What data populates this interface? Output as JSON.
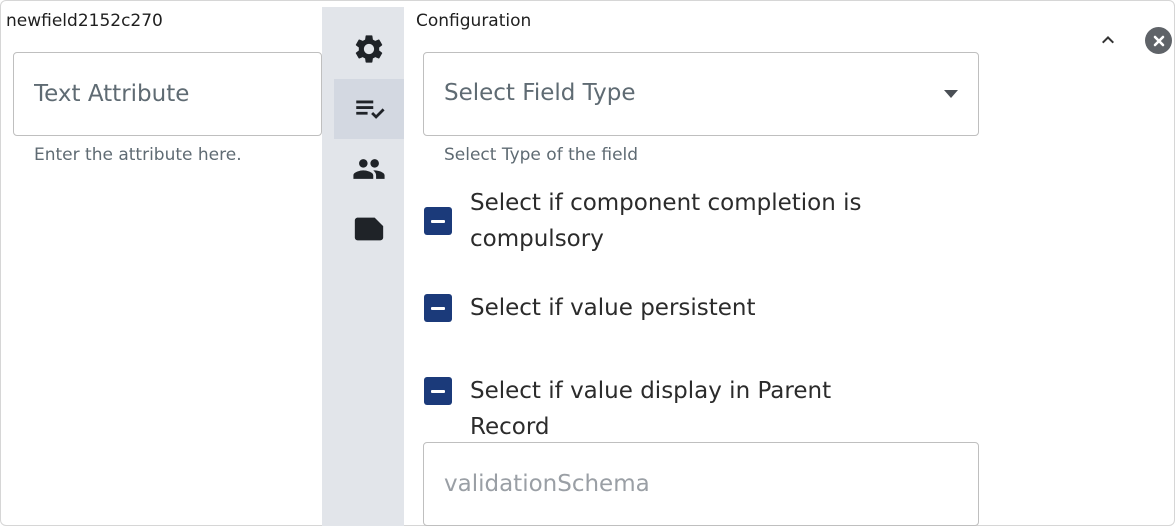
{
  "field": {
    "name": "newfield2152c270",
    "attribute_placeholder": "Text Attribute",
    "attribute_helper": "Enter the attribute here."
  },
  "rail": {
    "items": [
      {
        "icon": "gear-icon",
        "active": false
      },
      {
        "icon": "checklist-icon",
        "active": true
      },
      {
        "icon": "people-icon",
        "active": false
      },
      {
        "icon": "note-icon",
        "active": false
      }
    ]
  },
  "config": {
    "title": "Configuration",
    "field_type_label": "Select Field Type",
    "field_type_helper": "Select Type of the field",
    "checkboxes": [
      {
        "label": "Select if component completion is compulsory",
        "state": "indeterminate"
      },
      {
        "label": "Select if value persistent",
        "state": "indeterminate"
      },
      {
        "label": "Select if value display in Parent Record",
        "state": "indeterminate"
      }
    ],
    "validation_placeholder": "validationSchema"
  },
  "header_icons": {
    "collapse": "chevron-up-icon",
    "close": "close-icon"
  },
  "colors": {
    "checkbox": "#1b3a7a",
    "rail_bg": "#e2e5ea",
    "rail_active": "#d3d8e1"
  }
}
